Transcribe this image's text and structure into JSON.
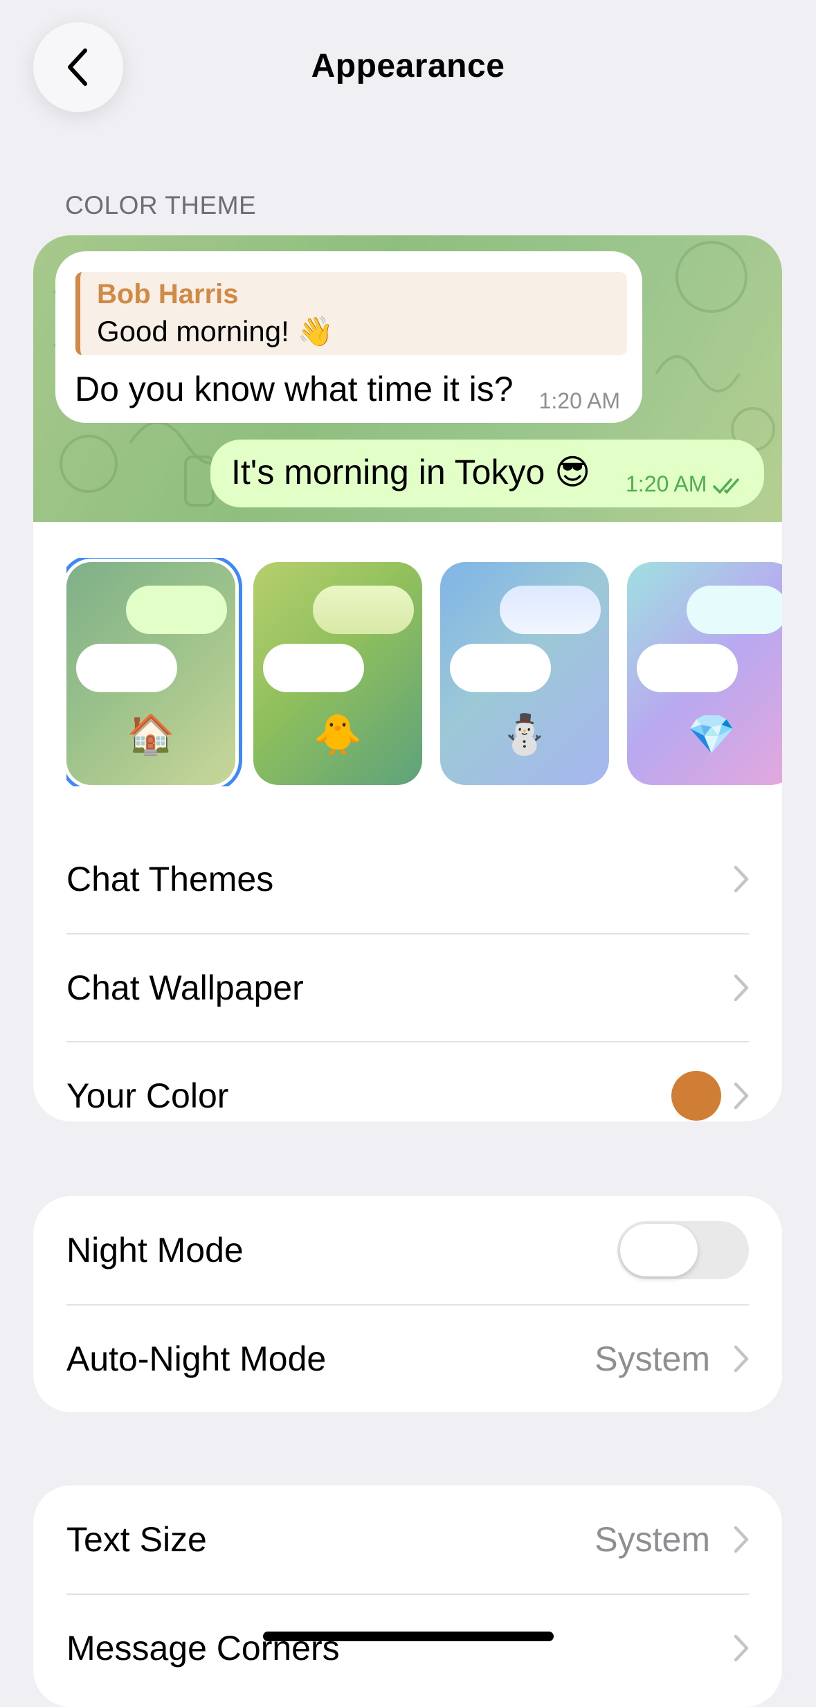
{
  "header": {
    "title": "Appearance"
  },
  "color_theme": {
    "section_label": "COLOR THEME",
    "preview": {
      "incoming": {
        "reply_name": "Bob Harris",
        "reply_text": "Good morning! 👋",
        "text": "Do you know what time it is?",
        "time": "1:20 AM"
      },
      "outgoing": {
        "text": "It's morning in Tokyo 😎",
        "time": "1:20 AM"
      }
    },
    "themes": [
      {
        "emoji": "🏠",
        "selected": true
      },
      {
        "emoji": "🐥",
        "selected": false
      },
      {
        "emoji": "⛄",
        "selected": false
      },
      {
        "emoji": "💎",
        "selected": false
      }
    ],
    "rows": {
      "chat_themes": "Chat Themes",
      "chat_wallpaper": "Chat Wallpaper",
      "your_color": "Your Color",
      "your_color_value": "#D07E35"
    }
  },
  "night": {
    "night_mode": "Night Mode",
    "night_mode_on": false,
    "auto_night_mode": "Auto-Night Mode",
    "auto_night_mode_value": "System"
  },
  "text_section": {
    "text_size": "Text Size",
    "text_size_value": "System",
    "message_corners": "Message Corners"
  },
  "colors": {
    "accent_blue": "#3E88F7",
    "name_orange": "#D08A45",
    "outgoing_bubble": "#E1FFC7",
    "check_green": "#4FAE4E"
  }
}
